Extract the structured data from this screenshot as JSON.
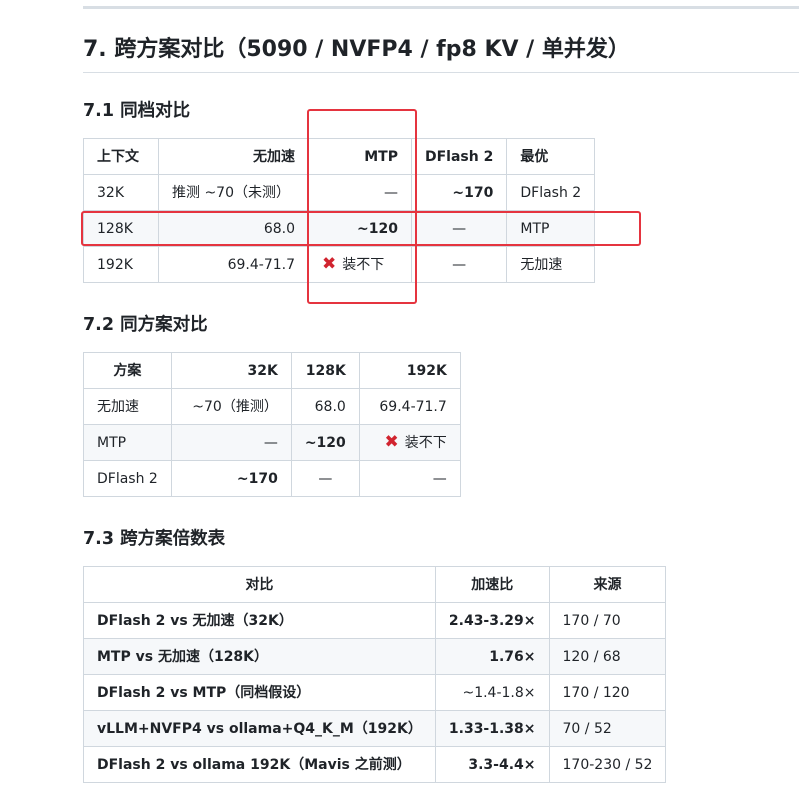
{
  "heading": "7. 跨方案对比（5090 / NVFP4 / fp8 KV / 单并发）",
  "sections": [
    {
      "title": "7.1 同档对比",
      "headers": [
        "上下文",
        "无加速",
        "MTP",
        "DFlash 2",
        "最优"
      ],
      "rows": [
        [
          "32K",
          "推测 ~70（未测）",
          "—",
          "~170",
          "DFlash 2"
        ],
        [
          "128K",
          "68.0",
          "~120",
          "—",
          "MTP"
        ],
        [
          "192K",
          "69.4-71.7",
          "装不下",
          "—",
          "无加速"
        ]
      ]
    },
    {
      "title": "7.2 同方案对比",
      "headers": [
        "方案",
        "32K",
        "128K",
        "192K"
      ],
      "rows": [
        [
          "无加速",
          "~70（推测）",
          "68.0",
          "69.4-71.7"
        ],
        [
          "MTP",
          "—",
          "~120",
          "装不下"
        ],
        [
          "DFlash 2",
          "~170",
          "—",
          "—"
        ]
      ]
    },
    {
      "title": "7.3 跨方案倍数表",
      "headers": [
        "对比",
        "加速比",
        "来源"
      ],
      "rows": [
        [
          "DFlash 2 vs 无加速（32K）",
          "2.43-3.29×",
          "170 / 70"
        ],
        [
          "MTP vs 无加速（128K）",
          "1.76×",
          "120 / 68"
        ],
        [
          "DFlash 2 vs MTP（同档假设）",
          "~1.4-1.8×",
          "170 / 120"
        ],
        [
          "vLLM+NVFP4 vs ollama+Q4_K_M（192K）",
          "1.33-1.38×",
          "70 / 52"
        ],
        [
          "DFlash 2 vs ollama 192K（Mavis 之前测）",
          "3.3-4.4×",
          "170-230 / 52"
        ]
      ]
    }
  ],
  "icons": {
    "cross": "✖",
    "cross_color": "#d1242f"
  },
  "highlight_color": "#e5343f"
}
